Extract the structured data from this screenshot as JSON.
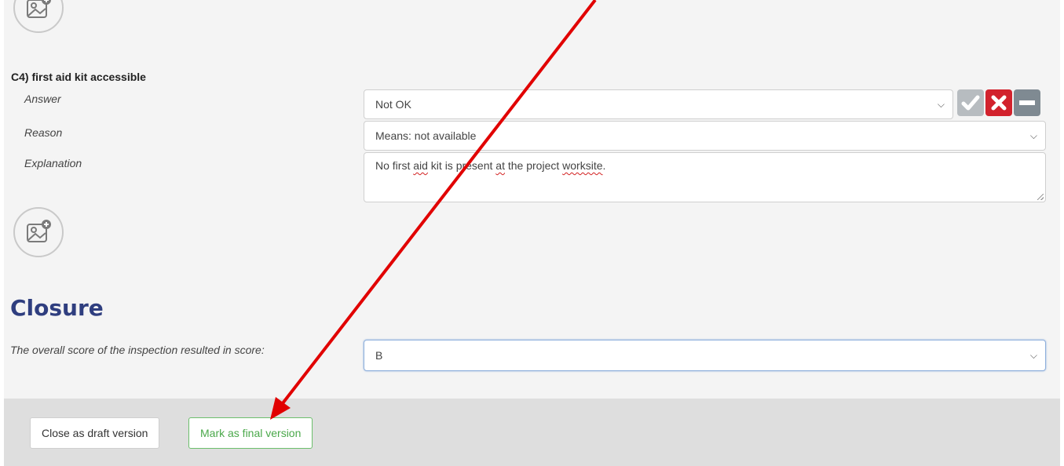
{
  "question": {
    "title": "C4) first aid kit accessible",
    "answer_label": "Answer",
    "answer_value": "Not OK",
    "reason_label": "Reason",
    "reason_value": "Means: not available",
    "explanation_label": "Explanation",
    "explanation_parts": {
      "p1": "No first ",
      "p2": "aid",
      "p3": " kit is present ",
      "p4": "at",
      "p5": " ",
      "p6": "the",
      "p7": " project ",
      "p8": "worksite",
      "p9": "."
    },
    "answer_buttons": [
      {
        "icon": "check-icon",
        "color": "#b7bcc0"
      },
      {
        "icon": "x-icon",
        "color": "#d2222d"
      },
      {
        "icon": "minus-icon",
        "color": "#7f8a92"
      }
    ]
  },
  "photo_icon": "add-photo-icon",
  "closure": {
    "heading": "Closure",
    "score_label": "The overall score of the inspection resulted in score:",
    "score_value": "B"
  },
  "footer": {
    "draft_label": "Close as draft version",
    "final_label": "Mark as final version"
  },
  "annotation": {
    "color": "#e10000"
  }
}
